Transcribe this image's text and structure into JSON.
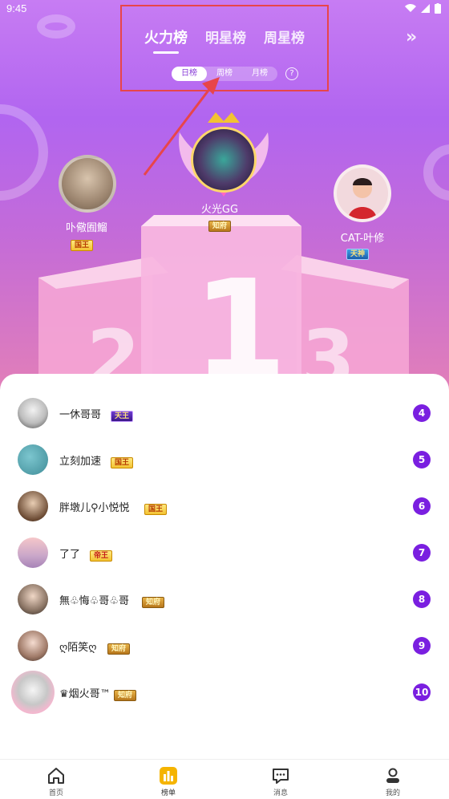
{
  "status_bar": {
    "time": "9:45"
  },
  "tabs": {
    "main": [
      {
        "label": "火力榜",
        "active": true
      },
      {
        "label": "明星榜",
        "active": false
      },
      {
        "label": "周星榜",
        "active": false
      }
    ],
    "sub": [
      {
        "label": "日榜",
        "active": true
      },
      {
        "label": "周榜",
        "active": false
      },
      {
        "label": "月榜",
        "active": false
      }
    ],
    "help_symbol": "?",
    "more_symbol": "»"
  },
  "podium": {
    "first": {
      "name": "火光GG",
      "badge": "知府",
      "rank_digit": "1"
    },
    "second": {
      "name": "卟儆囿鰡",
      "badge": "国王",
      "rank_digit": "2"
    },
    "third": {
      "name": "CAT-叶修",
      "badge": "天神",
      "rank_digit": "3"
    }
  },
  "ranking": [
    {
      "rank": "4",
      "name": "一休哥哥",
      "badge": "天王"
    },
    {
      "rank": "5",
      "name": "立刻加速",
      "badge": "国王"
    },
    {
      "rank": "6",
      "name": "胖墩儿⚲小悦悦",
      "badge": "国王"
    },
    {
      "rank": "7",
      "name": "了了",
      "badge": "帝王"
    },
    {
      "rank": "8",
      "name": "無♧悔♧哥♧哥",
      "badge": "知府"
    },
    {
      "rank": "9",
      "name": "ღ陌笑ღ",
      "badge": "知府"
    },
    {
      "rank": "10",
      "name": "♛烟火哥™",
      "badge": "知府"
    }
  ],
  "bottom_nav": [
    {
      "label": "首页",
      "icon": "home-icon",
      "active": false
    },
    {
      "label": "榜单",
      "icon": "chart-icon",
      "active": true
    },
    {
      "label": "消息",
      "icon": "message-icon",
      "active": false
    },
    {
      "label": "我的",
      "icon": "profile-icon",
      "active": false
    }
  ],
  "colors": {
    "accent": "#7a1fe0",
    "nav_active": "#f5b400",
    "highlight_box": "#e8454a"
  }
}
